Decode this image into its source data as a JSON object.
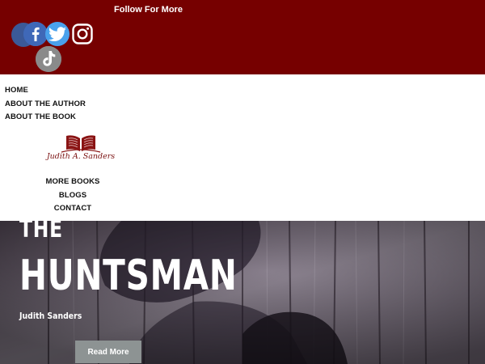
{
  "header": {
    "follow_text": "Follow For More",
    "social_icons": [
      "facebook-icon",
      "twitter-icon",
      "instagram-icon",
      "tiktok-icon"
    ],
    "bg_color": "#760000"
  },
  "nav": {
    "left_items": [
      "HOME",
      "ABOUT THE AUTHOR",
      "ABOUT THE BOOK"
    ],
    "center_items": [
      "MORE BOOKS",
      "BLOGS",
      "CONTACT"
    ]
  },
  "logo": {
    "text": "Judith A. Sanders",
    "icon": "open-book-icon",
    "color": "#7a1010"
  },
  "hero": {
    "title_line1": "THE",
    "title_line2": "HUNTSMAN",
    "author": "Judith Sanders",
    "button_label": "Read More",
    "button_color": "#8d9393"
  }
}
